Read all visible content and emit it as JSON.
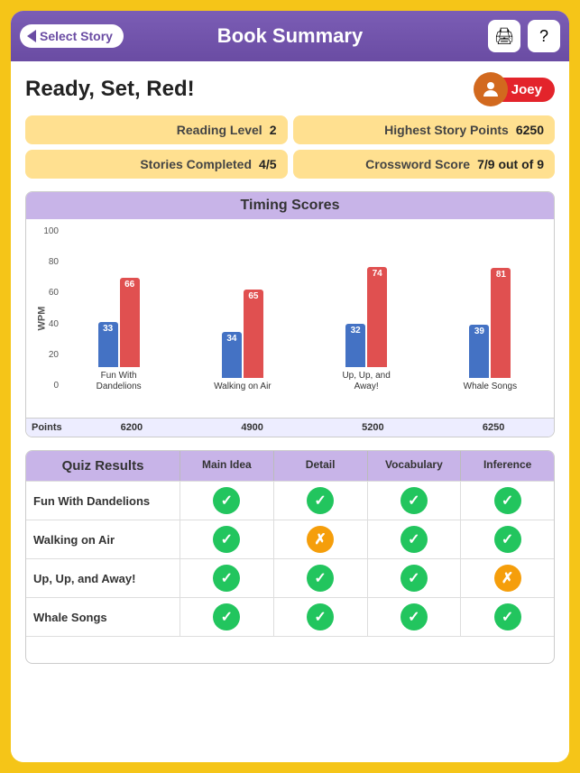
{
  "header": {
    "back_label": "Select Story",
    "title": "Book Summary",
    "print_icon": "🖨",
    "help_icon": "?"
  },
  "user": {
    "name": "Joey",
    "avatar": "👤"
  },
  "book": {
    "title": "Ready, Set, Red!"
  },
  "stats": [
    {
      "label": "Reading Level",
      "value": "2"
    },
    {
      "label": "Highest Story Points",
      "value": "6250"
    },
    {
      "label": "Stories Completed",
      "value": "4/5"
    },
    {
      "label": "Crossword Score",
      "value": "7/9 out of 9"
    }
  ],
  "chart": {
    "title": "Timing Scores",
    "y_label": "WPM",
    "y_ticks": [
      "100",
      "80",
      "60",
      "40",
      "20",
      "0"
    ],
    "points_label": "Points",
    "groups": [
      {
        "label": "Fun With\nDandelions",
        "blue": 33,
        "red": 66,
        "points": "6200"
      },
      {
        "label": "Walking on Air",
        "blue": 34,
        "red": 65,
        "points": "4900"
      },
      {
        "label": "Up, Up, and\nAway!",
        "blue": 32,
        "red": 74,
        "points": "5200"
      },
      {
        "label": "Whale Songs",
        "blue": 39,
        "red": 81,
        "points": "6250"
      }
    ],
    "max": 100
  },
  "quiz": {
    "title": "Quiz Results",
    "columns": [
      "Main Idea",
      "Detail",
      "Vocabulary",
      "Inference"
    ],
    "rows": [
      {
        "label": "Fun With Dandelions",
        "results": [
          "check",
          "check",
          "check",
          "check"
        ]
      },
      {
        "label": "Walking on Air",
        "results": [
          "check",
          "cross",
          "check",
          "check"
        ]
      },
      {
        "label": "Up, Up, and Away!",
        "results": [
          "check",
          "check",
          "check",
          "cross"
        ]
      },
      {
        "label": "Whale Songs",
        "results": [
          "check",
          "check",
          "check",
          "check"
        ]
      }
    ]
  }
}
